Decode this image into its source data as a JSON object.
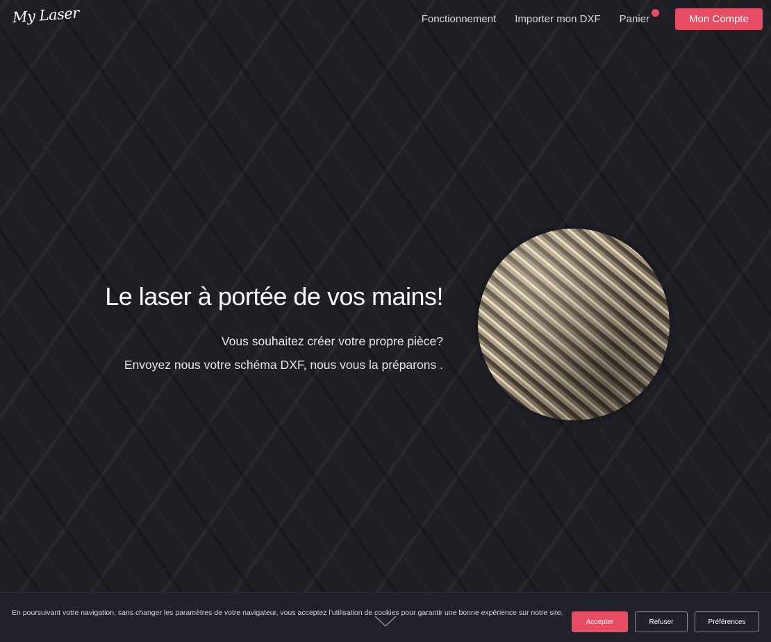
{
  "header": {
    "logo": "My Laser",
    "nav": [
      {
        "label": "Fonctionnement"
      },
      {
        "label": "Importer mon DXF"
      },
      {
        "label": "Panier"
      }
    ],
    "cart_badge_color": "#e64d62",
    "account_button": "Mon Compte"
  },
  "hero": {
    "title": "Le laser à portée de vos mains!",
    "line1": "Vous souhaitez créer votre propre pièce?",
    "line2": "Envoyez nous votre schéma DXF, nous vous la préparons .",
    "image_desc": "rebar-photo"
  },
  "cookie": {
    "text": "En poursuivant votre navigation, sans changer les paramètres de votre navigateur, vous acceptez l'utilisation de cookies pour garantir une bonne expérience sur notre site.",
    "accept": "Accepter",
    "refuse": "Refuser",
    "preferences": "Préférences"
  },
  "colors": {
    "accent": "#e64d62",
    "background": "#1f1f26"
  },
  "icons": {
    "scroll": "chevron-down-icon"
  }
}
